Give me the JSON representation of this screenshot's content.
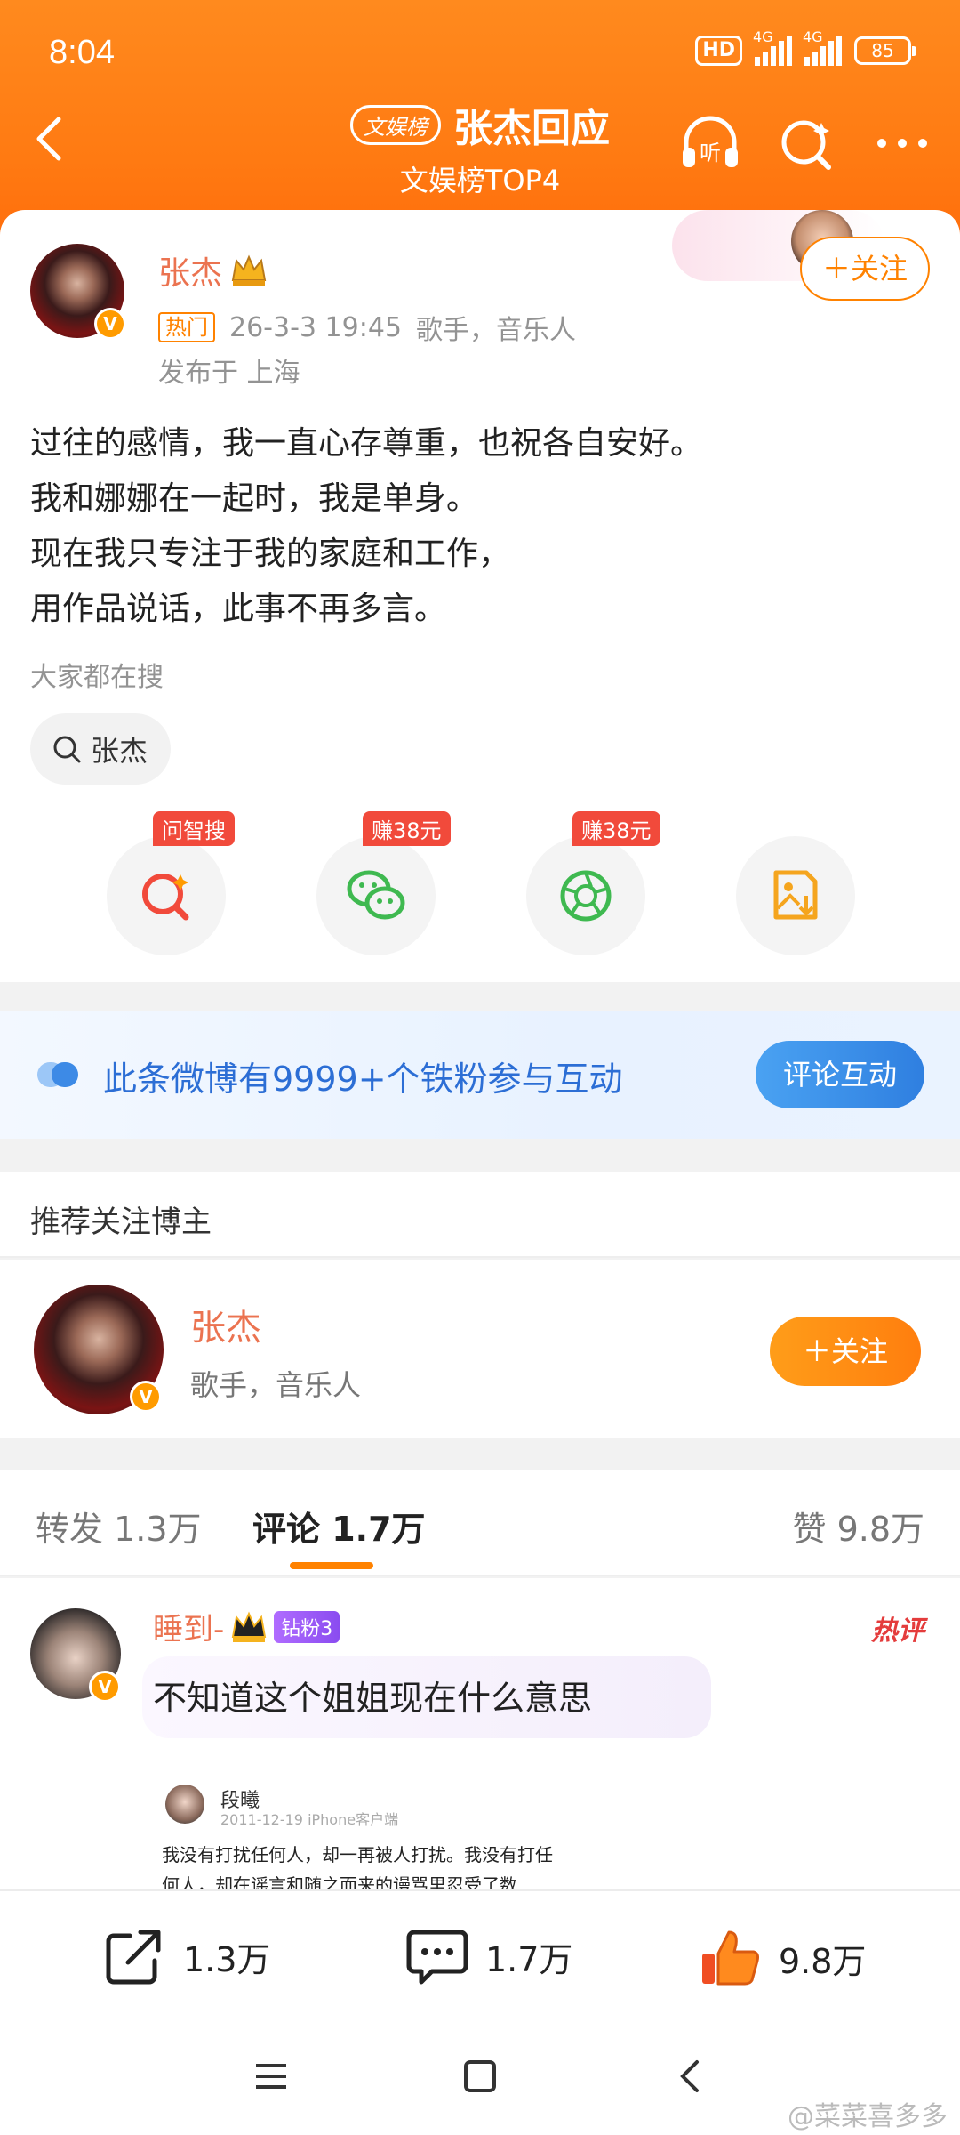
{
  "status_bar": {
    "time": "8:04",
    "hd": "HD",
    "net1": "4G",
    "net2": "4G",
    "battery": "85"
  },
  "nav": {
    "tag": "文娱榜",
    "title": "张杰回应",
    "subtitle": "文娱榜TOP4",
    "listen_icon": "listen-icon",
    "search_icon": "search-icon",
    "more_icon": "more-icon"
  },
  "post": {
    "author": "张杰",
    "hot_tag": "热门",
    "time": "26-3-3 19:45",
    "bio": "歌手，音乐人",
    "location": "发布于 上海",
    "follow_label": "＋关注",
    "content_lines": [
      "过往的感情，我一直心存尊重，也祝各自安好。",
      "我和娜娜在一起时，我是单身。",
      "现在我只专注于我的家庭和工作，",
      "用作品说话，此事不再多言。"
    ],
    "search_hint": "大家都在搜",
    "search_chip": "张杰",
    "actions": [
      {
        "icon": "ask-search-icon",
        "tag": "问智搜"
      },
      {
        "icon": "wechat-icon",
        "tag": "赚38元"
      },
      {
        "icon": "moments-icon",
        "tag": "赚38元"
      },
      {
        "icon": "save-image-icon",
        "tag": ""
      }
    ]
  },
  "banner": {
    "text": "此条微博有9999+个铁粉参与互动",
    "button": "评论互动"
  },
  "recommend": {
    "header": "推荐关注博主",
    "name": "张杰",
    "desc": "歌手，音乐人",
    "follow_label": "＋关注"
  },
  "tabs": {
    "repost": "转发 1.3万",
    "comments": "评论 1.7万",
    "likes": "赞 9.8万"
  },
  "comment": {
    "user": "睡到-",
    "fan_badge": "钻粉3",
    "hot_mark": "热评",
    "text": "不知道这个姐姐现在什么意思",
    "quote": {
      "name": "段曦",
      "meta": "2011-12-19  iPhone客户端",
      "text": "我没有打扰任何人，却一再被人打扰。我没有打任何人，却在谣言和随之而来的谩骂里忍受了数"
    }
  },
  "bottom_bar": {
    "repost": "1.3万",
    "comment": "1.7万",
    "like": "9.8万"
  },
  "watermark": "@菜菜喜多多",
  "colors": {
    "brand_orange": "#ff8200",
    "name_orange": "#eb7350",
    "link_blue": "#2c6ed5"
  }
}
